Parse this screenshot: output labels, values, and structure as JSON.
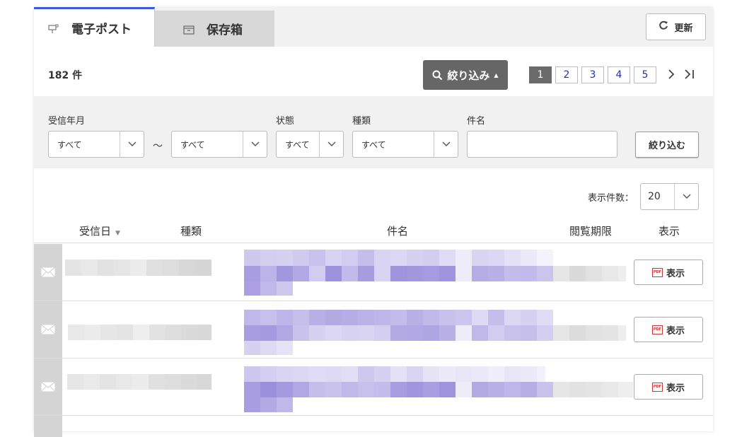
{
  "tabs": [
    {
      "label": "電子ポスト",
      "icon": "mailbox-icon",
      "active": true
    },
    {
      "label": "保存箱",
      "icon": "archive-box-icon",
      "active": false
    }
  ],
  "refresh": {
    "label": "更新",
    "icon": "refresh-icon"
  },
  "summary": {
    "count": "182 件"
  },
  "filter_toggle": {
    "label": "絞り込み",
    "icon": "search-icon"
  },
  "pagination": {
    "pages": [
      "1",
      "2",
      "3",
      "4",
      "5"
    ],
    "current": "1"
  },
  "filters": {
    "received_label": "受信年月",
    "received_from": "すべて",
    "tilde": "～",
    "received_to": "すべて",
    "status_label": "状態",
    "status_value": "すべて",
    "type_label": "種類",
    "type_value": "すべて",
    "subject_label": "件名",
    "subject_value": "",
    "apply_label": "絞り込む"
  },
  "display": {
    "label": "表示件数：",
    "value": "20"
  },
  "table": {
    "columns": {
      "received": "受信日",
      "type": "種類",
      "subject": "件名",
      "expires": "閲覧期限",
      "view": "表示"
    },
    "rows": [
      {
        "view_label": "表示"
      },
      {
        "view_label": "表示"
      },
      {
        "view_label": "表示"
      }
    ]
  },
  "colors": {
    "accent": "#3b5bd6",
    "link": "#2233aa",
    "filter_button": "#666666",
    "pdf_red": "#cc3333",
    "redaction_purple": "#a59ae0"
  }
}
